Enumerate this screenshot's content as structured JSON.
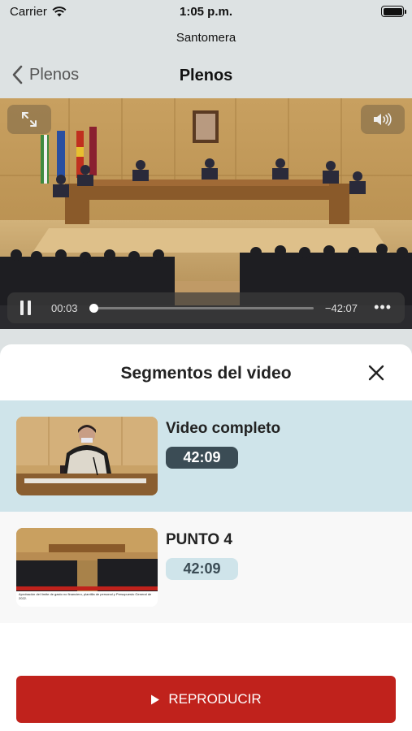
{
  "status_bar": {
    "carrier": "Carrier",
    "time": "1:05 p.m."
  },
  "app": {
    "name": "Santomera"
  },
  "nav": {
    "back_label": "Plenos",
    "title": "Plenos"
  },
  "player": {
    "elapsed": "00:03",
    "remaining": "−42:07",
    "progress": 0.0012,
    "more_label": "•••"
  },
  "sheet": {
    "title": "Segmentos del video",
    "segments": [
      {
        "title": "Video completo",
        "duration": "42:09",
        "selected": true
      },
      {
        "title": "PUNTO 4",
        "duration": "42:09",
        "selected": false,
        "thumb_caption": "Aprobación del límite de gasto no financiero, plantilla de personal y Presupuesto General de 2022."
      }
    ]
  },
  "action": {
    "play_label": "REPRODUCIR"
  },
  "icons": [
    "wifi-icon",
    "battery-icon",
    "back-chevron-icon",
    "expand-icon",
    "speaker-icon",
    "pause-icon",
    "close-icon",
    "play-icon"
  ],
  "colors": {
    "accent_red": "#c0221c",
    "selected_row": "#cfe4ea",
    "badge_dark": "#3b4c55",
    "header_bg": "#dde2e3"
  }
}
